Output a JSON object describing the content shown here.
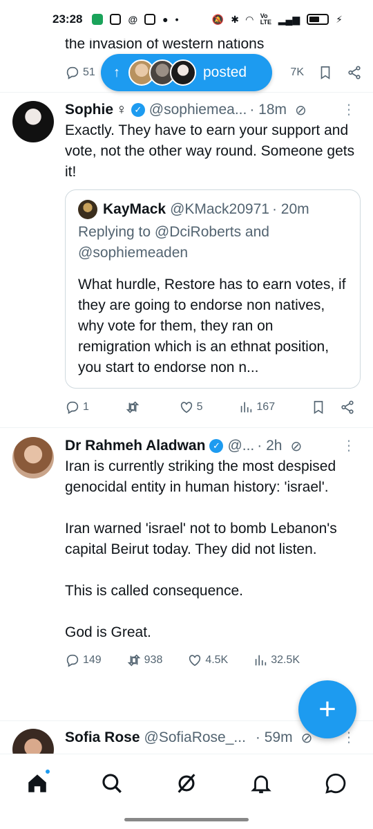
{
  "status_bar": {
    "time": "23:28",
    "signal_label": "Vo LTE"
  },
  "top_partial": {
    "text": "the invasion of western nations",
    "replies": "51",
    "views": "7K"
  },
  "posted_pill": {
    "label": "posted",
    "arrow": "↑"
  },
  "tweets": [
    {
      "name": "Sophie",
      "name_suffix": "♀",
      "handle": "@sophiemea...",
      "time": "· 18m",
      "text": "Exactly. They have to earn your support and vote, not the other way round. Someone gets it!",
      "quote": {
        "name": "KayMack",
        "handle": "@KMack20971",
        "time": "· 20m",
        "reply_to": "Replying to @DciRoberts and @sophiemeaden",
        "text": "What hurdle, Restore has to earn votes, if they are going to endorse non natives, why vote for them, they ran on remigration which is an ethnat position, you start to endorse non n..."
      },
      "replies": "1",
      "reposts": "",
      "likes": "5",
      "views": "167"
    },
    {
      "name": "Dr Rahmeh Aladwan",
      "handle": "@...",
      "time": "· 2h",
      "text": "Iran is currently striking the most despised genocidal entity in human history: 'israel'.\n\nIran warned 'israel' not to bomb Lebanon's capital Beirut today. They did not listen.\n\nThis is called consequence.\n\nGod is Great.",
      "replies": "149",
      "reposts": "938",
      "likes": "4.5K",
      "views": "32.5K"
    },
    {
      "name": "Sofia Rose",
      "handle": "@SofiaRose_...",
      "time": "· 59m"
    }
  ],
  "fab": {
    "label": "+"
  },
  "colors": {
    "accent": "#1d9bf0",
    "text": "#0f1419",
    "secondary": "#536471"
  }
}
